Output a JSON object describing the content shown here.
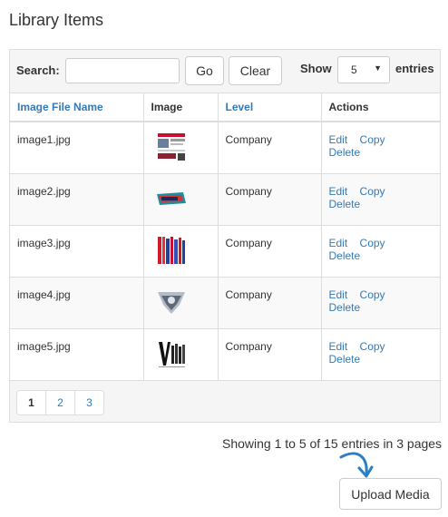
{
  "title": "Library Items",
  "search": {
    "label": "Search:",
    "value": "",
    "placeholder": "",
    "go_label": "Go",
    "clear_label": "Clear"
  },
  "page_size": {
    "show_label": "Show",
    "selected": "5",
    "entries_label": "entries"
  },
  "table": {
    "columns": [
      "Image File Name",
      "Image",
      "Level",
      "Actions"
    ],
    "rows": [
      {
        "file_name": "image1.jpg",
        "image": "webpage-screenshot-thumbnail",
        "level": "Company",
        "actions": [
          "Edit",
          "Copy",
          "Delete"
        ]
      },
      {
        "file_name": "image2.jpg",
        "image": "logo-thumbnail",
        "level": "Company",
        "actions": [
          "Edit",
          "Copy",
          "Delete"
        ]
      },
      {
        "file_name": "image3.jpg",
        "image": "magazine-cover-thumbnail",
        "level": "Company",
        "actions": [
          "Edit",
          "Copy",
          "Delete"
        ]
      },
      {
        "file_name": "image4.jpg",
        "image": "photo-thumbnail",
        "level": "Company",
        "actions": [
          "Edit",
          "Copy",
          "Delete"
        ]
      },
      {
        "file_name": "image5.jpg",
        "image": "magazine-cover-thumbnail",
        "level": "Company",
        "actions": [
          "Edit",
          "Copy",
          "Delete"
        ]
      }
    ]
  },
  "pagination": {
    "pages": [
      "1",
      "2",
      "3"
    ],
    "current": "1"
  },
  "status_text": "Showing 1 to 5 of 15 entries in 3 pages",
  "upload_label": "Upload Media",
  "colors": {
    "link": "#337ab7",
    "arrow": "#2a7fc6",
    "header_bg": "#f5f5f5",
    "stripe": "#f9f9f9"
  }
}
